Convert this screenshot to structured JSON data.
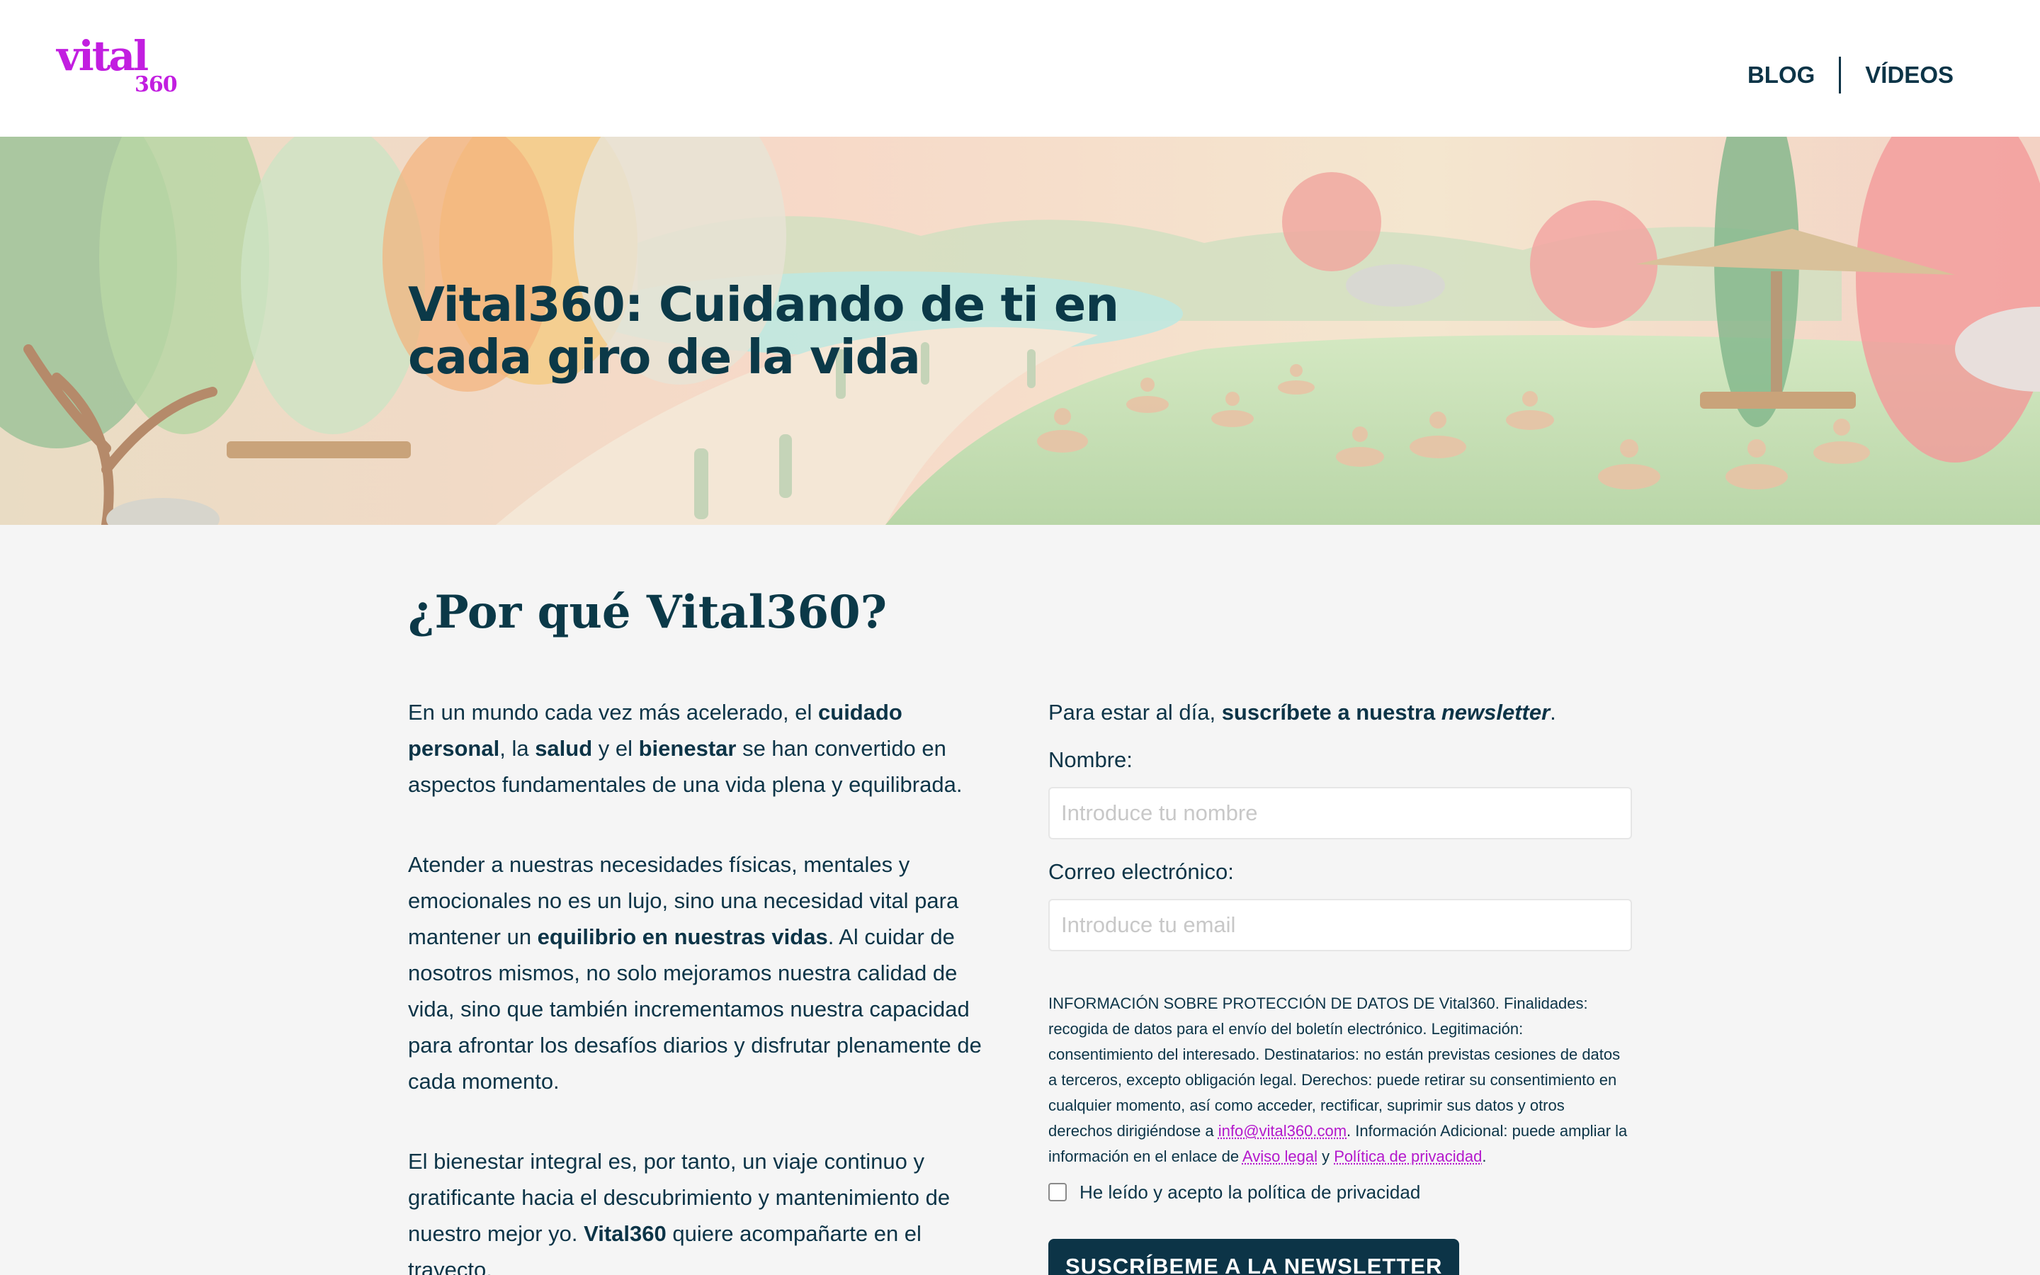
{
  "header": {
    "logo_word": "vital",
    "logo_num": "360",
    "nav": [
      {
        "label": "BLOG"
      },
      {
        "label": "VÍDEOS"
      }
    ]
  },
  "hero": {
    "title": "Vital360: Cuidando de ti en cada giro de la vida"
  },
  "main": {
    "section_title": "¿Por qué Vital360?",
    "paragraphs": {
      "p1": {
        "t1": "En un mundo cada vez más acelerado, el ",
        "b1": "cuidado personal",
        "t2": ", la ",
        "b2": "salud",
        "t3": " y el ",
        "b3": "bienestar",
        "t4": " se han convertido en aspectos fundamentales de una vida plena y equilibrada."
      },
      "p2": {
        "t1": "Atender a nuestras necesidades físicas, mentales y emocionales no es un lujo, sino una necesidad vital para mantener un ",
        "b1": "equilibrio en nuestras vidas",
        "t2": ". Al cuidar de nosotros mismos, no solo mejoramos nuestra calidad de vida, sino que también incrementamos nuestra capacidad para afrontar los desafíos diarios y disfrutar plenamente de cada momento."
      },
      "p3": {
        "t1": "El bienestar integral es, por tanto, un viaje continuo y gratificante hacia el descubrimiento y mantenimiento de nuestro mejor yo. ",
        "b1": "Vital360",
        "t2": " quiere acompañarte en el trayecto."
      }
    }
  },
  "newsletter": {
    "intro_t1": "Para estar al día, ",
    "intro_b1": "suscríbete a nuestra ",
    "intro_bi": "newsletter",
    "intro_t2": ".",
    "name_label": "Nombre:",
    "name_placeholder": "Introduce tu nombre",
    "email_label": "Correo electrónico:",
    "email_placeholder": "Introduce tu email",
    "legal_t1": "INFORMACIÓN SOBRE PROTECCIÓN DE DATOS DE Vital360. Finalidades: recogida de datos para el envío del boletín electrónico. Legitimación: consentimiento del interesado. Destinatarios: no están previstas cesiones de datos a terceros, excepto obligación legal. Derechos: puede retirar su consentimiento en cualquier momento, así como acceder, rectificar, suprimir sus datos y otros derechos dirigiéndose a ",
    "legal_email": "info@vital360.com",
    "legal_t2": ". Información Adicional: puede ampliar la información en el enlace de ",
    "legal_link1": "Aviso legal",
    "legal_t3": " y ",
    "legal_link2": "Política de privacidad",
    "legal_t4": ".",
    "consent_label": "He leído y acepto la política de privacidad",
    "submit_label": "SUSCRÍBEME A LA NEWSLETTER"
  },
  "colors": {
    "brand": "#c21ee0",
    "primary": "#0c3447",
    "background": "#f5f5f5"
  }
}
